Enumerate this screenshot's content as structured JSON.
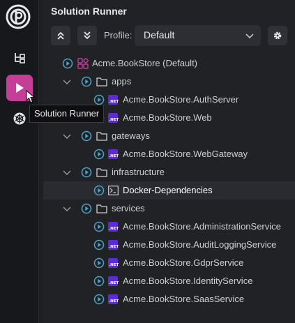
{
  "activity_bar": {
    "items": [
      {
        "name": "app-logo",
        "icon": "abp-logo-icon"
      },
      {
        "name": "explorer",
        "icon": "tree-view-icon"
      },
      {
        "name": "solution-runner",
        "icon": "play-icon",
        "active": true
      },
      {
        "name": "kubernetes",
        "icon": "kubernetes-helm-icon"
      }
    ],
    "tooltip": "Solution Runner",
    "accent_color": "#c43d97"
  },
  "panel": {
    "title": "Solution Runner",
    "toolbar": {
      "collapse_all_icon": "chevrons-up-icon",
      "expand_all_icon": "chevrons-down-icon",
      "profile_label": "Profile:",
      "profile_value": "Default",
      "settings_icon": "gear-icon"
    }
  },
  "tree": {
    "play_icon_color": "#4ea3c7",
    "net_badge_text": ".NET",
    "solution": "Acme.BookStore (Default)",
    "folders": [
      {
        "label": "apps",
        "items": [
          "Acme.BookStore.AuthServer",
          "Acme.BookStore.Web"
        ]
      },
      {
        "label": "gateways",
        "items": [
          "Acme.BookStore.WebGateway"
        ]
      },
      {
        "label": "infrastructure",
        "items": [
          "Docker-Dependencies"
        ]
      },
      {
        "label": "services",
        "items": [
          "Acme.BookStore.AdministrationService",
          "Acme.BookStore.AuditLoggingService",
          "Acme.BookStore.GdprService",
          "Acme.BookStore.IdentityService",
          "Acme.BookStore.SaasService"
        ]
      }
    ]
  }
}
